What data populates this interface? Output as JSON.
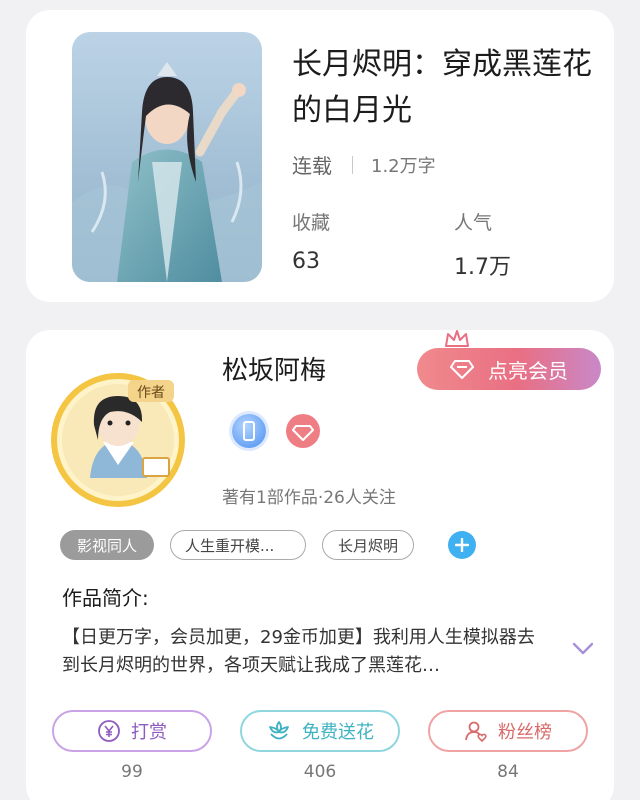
{
  "book": {
    "title": "长月烬明：穿成黑莲花的白月光",
    "status": "连载",
    "word_count": "1.2万字",
    "favorites_label": "收藏",
    "favorites_value": "63",
    "popularity_label": "人气",
    "popularity_value": "1.7万"
  },
  "author": {
    "name": "松坂阿梅",
    "avatar_badge_text": "作者",
    "vip_button": "点亮会员",
    "works_line": "著有1部作品·26人关注",
    "tags": [
      "影视同人",
      "人生重开模...",
      "长月烬明"
    ],
    "intro_heading": "作品简介:",
    "intro_text": "【日更万字，会员加更，29金币加更】我利用人生模拟器去到长月烬明的世界，各项天赋让我成了黑莲花…"
  },
  "actions": [
    {
      "label": "打赏",
      "count": "99"
    },
    {
      "label": "免费送花",
      "count": "406"
    },
    {
      "label": "粉丝榜",
      "count": "84"
    }
  ],
  "colors": {
    "vip_gradient_start": "#f08a8d",
    "vip_gradient_end": "#c988c8",
    "reward": "#8e5cc0",
    "flower": "#3fb2c2",
    "fans": "#d96a6a",
    "tag_add": "#3fb0f0"
  },
  "icons": [
    "diamond-icon",
    "crown-icon",
    "phone-badge-icon",
    "diamond-badge-icon",
    "plus-icon",
    "chevron-down-icon",
    "yen-coin-icon",
    "flower-icon",
    "fan-person-icon"
  ]
}
